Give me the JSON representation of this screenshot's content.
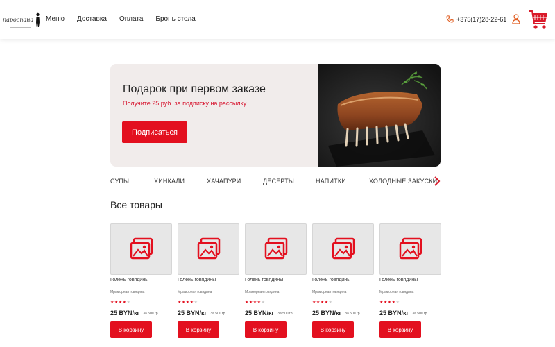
{
  "header": {
    "logo_text": "пароспана",
    "nav": [
      "Меню",
      "Доставка",
      "Оплата",
      "Бронь стола"
    ],
    "phone": "+375(17)28-22-61"
  },
  "promo": {
    "title": "Подарок при первом заказе",
    "subtitle": "Получите 25 руб. за подписку на рассылку",
    "button": "Подписаться"
  },
  "categories": [
    "СУПЫ",
    "ХИНКАЛИ",
    "ХАЧАПУРИ",
    "ДЕСЕРТЫ",
    "НАПИТКИ",
    "ХОЛОДНЫЕ ЗАКУСКИ"
  ],
  "section_title": "Все товары",
  "products": [
    {
      "name": "Голень говядины",
      "desc": "Мраморная говядина",
      "rating": 4,
      "max_rating": 5,
      "price": "25 BYN/кг",
      "weight": "За 500 гр.",
      "button": "В корзину"
    },
    {
      "name": "Голень говядины",
      "desc": "Мраморная говядина",
      "rating": 4,
      "max_rating": 5,
      "price": "25 BYN/кг",
      "weight": "За 500 гр.",
      "button": "В корзину"
    },
    {
      "name": "Голень говядины",
      "desc": "Мраморная говядина",
      "rating": 4,
      "max_rating": 5,
      "price": "25 BYN/кг",
      "weight": "За 500 гр.",
      "button": "В корзину"
    },
    {
      "name": "Голень говядины",
      "desc": "Мраморная говядина",
      "rating": 4,
      "max_rating": 5,
      "price": "25 BYN/кг",
      "weight": "За 500 гр.",
      "button": "В корзину"
    },
    {
      "name": "Голень говядины",
      "desc": "Мраморная говядина",
      "rating": 4,
      "max_rating": 5,
      "price": "25 BYN/кг",
      "weight": "За 500 гр.",
      "button": "В корзину"
    }
  ],
  "icons": {
    "phone": "phone-icon",
    "user": "user-icon",
    "cart": "cart-icon",
    "next": "chevron-right-icon",
    "placeholder": "image-placeholder-icon"
  },
  "colors": {
    "accent": "#e3101f",
    "promo_bg": "#f1eceb",
    "placeholder_bg": "#e7e7e7"
  }
}
